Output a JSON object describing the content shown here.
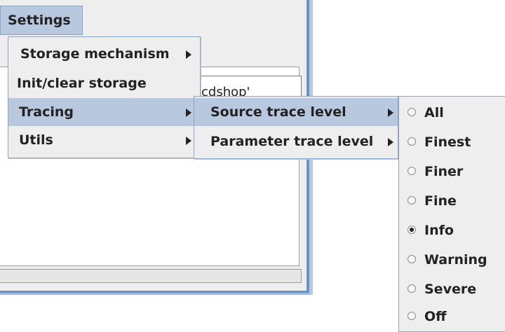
{
  "app": {
    "menubar": {
      "settings_label": "Settings"
    },
    "text_field_value": "cdshop'"
  },
  "settings_menu": {
    "items": [
      {
        "label": "Storage mechanism",
        "has_submenu": true
      },
      {
        "label": "Init/clear storage",
        "has_submenu": false
      },
      {
        "label": "Tracing",
        "has_submenu": true,
        "selected": true
      },
      {
        "label": "Utils",
        "has_submenu": true
      }
    ]
  },
  "tracing_menu": {
    "items": [
      {
        "label": "Source trace level",
        "has_submenu": true,
        "selected": true
      },
      {
        "label": "Parameter trace level",
        "has_submenu": true
      }
    ]
  },
  "source_trace_level_menu": {
    "options": [
      "All",
      "Finest",
      "Finer",
      "Fine",
      "Info",
      "Warning",
      "Severe",
      "Off"
    ],
    "checked": "Info"
  },
  "colors": {
    "menu_background": "#eeeeee",
    "selection": "#b8c9df",
    "border": "#8da4c4",
    "window_frame": "#6d93c6"
  }
}
